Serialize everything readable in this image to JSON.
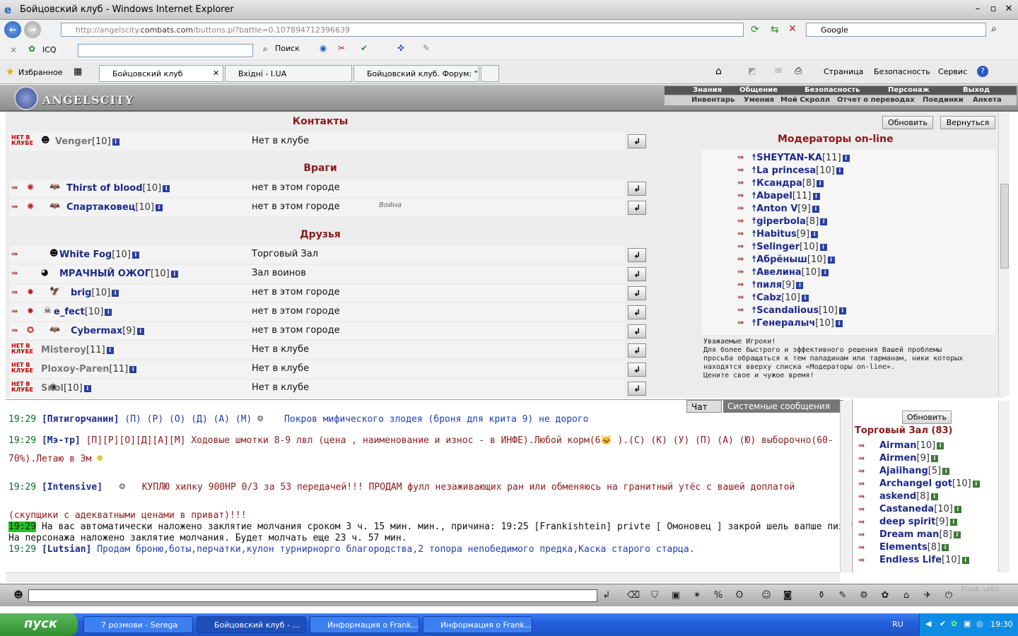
{
  "window": {
    "title": "Бойцовский клуб - Windows Internet Explorer"
  },
  "address": {
    "url_prefix": "http://angelscity.",
    "url_domain": "combats.com",
    "url_rest": "/buttons.pl?battle=0.107894712396639",
    "search_value": "Google"
  },
  "toolbar": {
    "icq": "ICQ",
    "search": "Поиск"
  },
  "favorites": {
    "label": "Избранное"
  },
  "tabs": [
    {
      "label": "Бойцовский клуб"
    },
    {
      "label": "Вхідні - I.UA"
    },
    {
      "label": "Бойцовский клуб. Форум: \"..."
    }
  ],
  "ie_cmd": {
    "page": "Страница",
    "safety": "Безопасность",
    "service": "Сервис"
  },
  "game": {
    "logo": "ANGELSCITY",
    "menu_top": [
      "Знания",
      "Общение",
      "Безопасность",
      "Персонаж",
      "Выход"
    ],
    "menu_bottom": [
      "Инвентарь",
      "Умения",
      "Мой Скролл",
      "Отчет о переводах",
      "Поединки",
      "Анкета"
    ]
  },
  "contacts": {
    "title": "Контакты",
    "rows": [
      {
        "name": "Venger",
        "level": "[10]",
        "location": "Нет в клубе",
        "status": "НЕТ В КЛУБЕ"
      }
    ]
  },
  "enemies": {
    "title": "Враги",
    "rows": [
      {
        "name": "Thirst of blood",
        "level": "[10]",
        "location": "нет в этом городе",
        "note": ""
      },
      {
        "name": "Спартаковец",
        "level": "[10]",
        "location": "нет в этом городе",
        "note": "Война"
      }
    ]
  },
  "friends": {
    "title": "Друзья",
    "rows": [
      {
        "name": "White Fog",
        "level": "[10]",
        "location": "Торговый Зал"
      },
      {
        "name": "МРАЧНЫЙ ОЖОГ",
        "level": "[10]",
        "location": "Зал воинов"
      },
      {
        "name": "brig",
        "level": "[10]",
        "location": "нет в этом городе"
      },
      {
        "name": "e_fect",
        "level": "[10]",
        "location": "нет в этом городе"
      },
      {
        "name": "Cybermax",
        "level": "[9]",
        "location": "нет в этом городе"
      },
      {
        "name": "Misteroy",
        "level": "[11]",
        "location": "Нет в клубе"
      },
      {
        "name": "Ploxoy-Paren",
        "level": "[11]",
        "location": "Нет в клубе"
      },
      {
        "name": "Snol",
        "level": "[10]",
        "location": "Нет в клубе"
      }
    ]
  },
  "moderators": {
    "refresh": "Обновить",
    "back": "Вернуться",
    "title": "Модераторы on-line",
    "list": [
      {
        "name": "SHEYTAN-KA",
        "level": "[11]"
      },
      {
        "name": "La princesa",
        "level": "[10]"
      },
      {
        "name": "Ксандра",
        "level": "[8]"
      },
      {
        "name": "Abapel",
        "level": "[11]"
      },
      {
        "name": "Anton V",
        "level": "[9]"
      },
      {
        "name": "giperbola",
        "level": "[8]"
      },
      {
        "name": "Habitus",
        "level": "[9]"
      },
      {
        "name": "Selinger",
        "level": "[10]"
      },
      {
        "name": "Абрёныш",
        "level": "[10]"
      },
      {
        "name": "Авелина",
        "level": "[10]"
      },
      {
        "name": "пиля",
        "level": "[9]"
      },
      {
        "name": "Cabz",
        "level": "[10]"
      },
      {
        "name": "Scandalious",
        "level": "[10]"
      },
      {
        "name": "Генералыч",
        "level": "[10]"
      }
    ],
    "notice": [
      "Уважаемые Игроки!",
      "Для более быстрого и эффективного решения Вашей проблемы",
      "просьба обращаться к тем паладинам или тарманам, ники которых",
      "находятся вверху списка «Модераторы on-line».",
      "Цените свое и чужое время!"
    ]
  },
  "chat": {
    "tab_chat": "Чат",
    "tab_system": "Системные сообщения",
    "lines": [
      {
        "time": "19:29",
        "nick": "Пятигорчанин",
        "tail": " (П) (Р) (О) (Д) (А) (М)",
        "text": "Покров мифического злодея (броня для крита 9) не дорого"
      },
      {
        "time": "19:29",
        "nick": "Мэ-тр",
        "tail": " [П][Р][О][Д][А][М]",
        "text": "Ходовые шмотки 8-9 лвл (цена , наименование и износ - в ИНФЕ).Любой корм(6",
        "text2": ").(С) (К) (У) (П) (А) (Ю) выборочно(60-",
        "text3": "70%).Летаю в Эм"
      },
      {
        "time": "19:29",
        "nick": "Intensive",
        "text": "КУПЛЮ хилку 900НР 0/3 за 53 передачей!!! ПРОДАМ фулл незаживающих ран или обменяюсь на гранитный утёс с вашей доплатой",
        "text2": "(скупщики с адекватными ценами в приват)!!!"
      },
      {
        "time": "19:29",
        "sys": "На вас автоматически наложено заклятие молчания сроком 3 ч. 15 мин. мин., причина: 19:25 [Frankishtein] privte [ Омоновец ] закрой шель вапше пиздпбол. ...",
        "sys2": "На персонажа наложено заклятие молчания. Будет молчать еще 23 ч. 57 мин."
      },
      {
        "time": "19:29",
        "nick": "Lutsian",
        "text": "Продам броню,боты,перчатки,кулон турнирнорго благородства,2 топора непобедимого предка,Каска старого старца."
      }
    ]
  },
  "online": {
    "refresh": "Обновить",
    "room": "Торговый Зал (83)",
    "list": [
      {
        "name": "Airman",
        "level": "[10]"
      },
      {
        "name": "Airmen",
        "level": "[9]"
      },
      {
        "name": "Ajaiihang",
        "level": "[5]"
      },
      {
        "name": "Archangel got",
        "level": "[10]"
      },
      {
        "name": "askend",
        "level": "[8]"
      },
      {
        "name": "Castaneda",
        "level": "[10]"
      },
      {
        "name": "deep spirit",
        "level": "[9]"
      },
      {
        "name": "Dream man",
        "level": "[8]"
      },
      {
        "name": "Elements",
        "level": "[8]"
      },
      {
        "name": "Endless Life",
        "level": "[10]"
      }
    ]
  },
  "bottom": {
    "flash": "Flash забл"
  },
  "taskbar": {
    "start": "пуск",
    "items": [
      "7 розмови - Serega",
      "Бойцовский клуб - ...",
      "Информация о Frank...",
      "Информация о Frank..."
    ],
    "lang": "RU",
    "clock": "19:30"
  }
}
